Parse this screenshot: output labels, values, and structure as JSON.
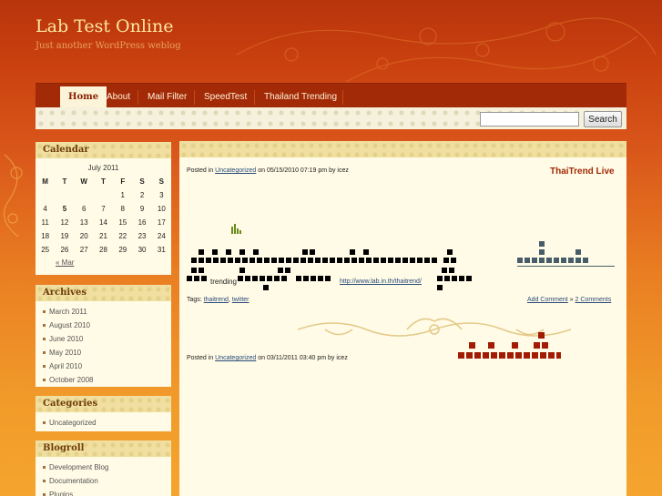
{
  "site": {
    "title": "Lab Test Online",
    "description": "Just another WordPress weblog"
  },
  "nav": {
    "items": [
      {
        "label": "Home",
        "active": true
      },
      {
        "label": "About"
      },
      {
        "label": "Mail Filter"
      },
      {
        "label": "SpeedTest"
      },
      {
        "label": "Thailand Trending"
      }
    ]
  },
  "search": {
    "value": "",
    "button_label": "Search"
  },
  "calendar": {
    "title": "Calendar",
    "caption": "July 2011",
    "weekdays": [
      "M",
      "T",
      "W",
      "T",
      "F",
      "S",
      "S"
    ],
    "weeks": [
      [
        "",
        "",
        "",
        "",
        "1",
        "2",
        "3"
      ],
      [
        "4",
        "5",
        "6",
        "7",
        "8",
        "9",
        "10"
      ],
      [
        "11",
        "12",
        "13",
        "14",
        "15",
        "16",
        "17"
      ],
      [
        "18",
        "19",
        "20",
        "21",
        "22",
        "23",
        "24"
      ],
      [
        "25",
        "26",
        "27",
        "28",
        "29",
        "30",
        "31"
      ]
    ],
    "bold_day": "5",
    "prev_label": "« Mar"
  },
  "archives": {
    "title": "Archives",
    "items": [
      "March 2011",
      "August 2010",
      "June 2010",
      "May 2010",
      "April 2010",
      "October 2008"
    ]
  },
  "categories": {
    "title": "Categories",
    "items": [
      "Uncategorized"
    ]
  },
  "blogroll": {
    "title": "Blogroll",
    "items": [
      "Development Blog",
      "Documentation",
      "Plugins"
    ]
  },
  "posts": [
    {
      "meta_prefix": "Posted in ",
      "category": "Uncategorized",
      "meta_suffix": " on 05/15/2010 07:19 pm by icez",
      "title": "ThaiTrend Live",
      "trend_word": "trending",
      "trend_url": "http://www.lab.in.th/thaitrend/",
      "tags_label": "Tags: ",
      "tags": [
        "thaitrend",
        "twitter"
      ],
      "add_comment": "Add Comment",
      "comments_sep": " » ",
      "comments_count": "2 Comments"
    },
    {
      "meta_prefix": "Posted in ",
      "category": "Uncategorized",
      "meta_suffix": " on 03/11/2011 03:40 pm by icez"
    }
  ],
  "colors": {
    "accent": "#a32a06",
    "title_text": "#fbe8a0",
    "pixel_dark": "#000000",
    "pixel_slate": "#475d6a",
    "pixel_red": "#a31a05"
  }
}
